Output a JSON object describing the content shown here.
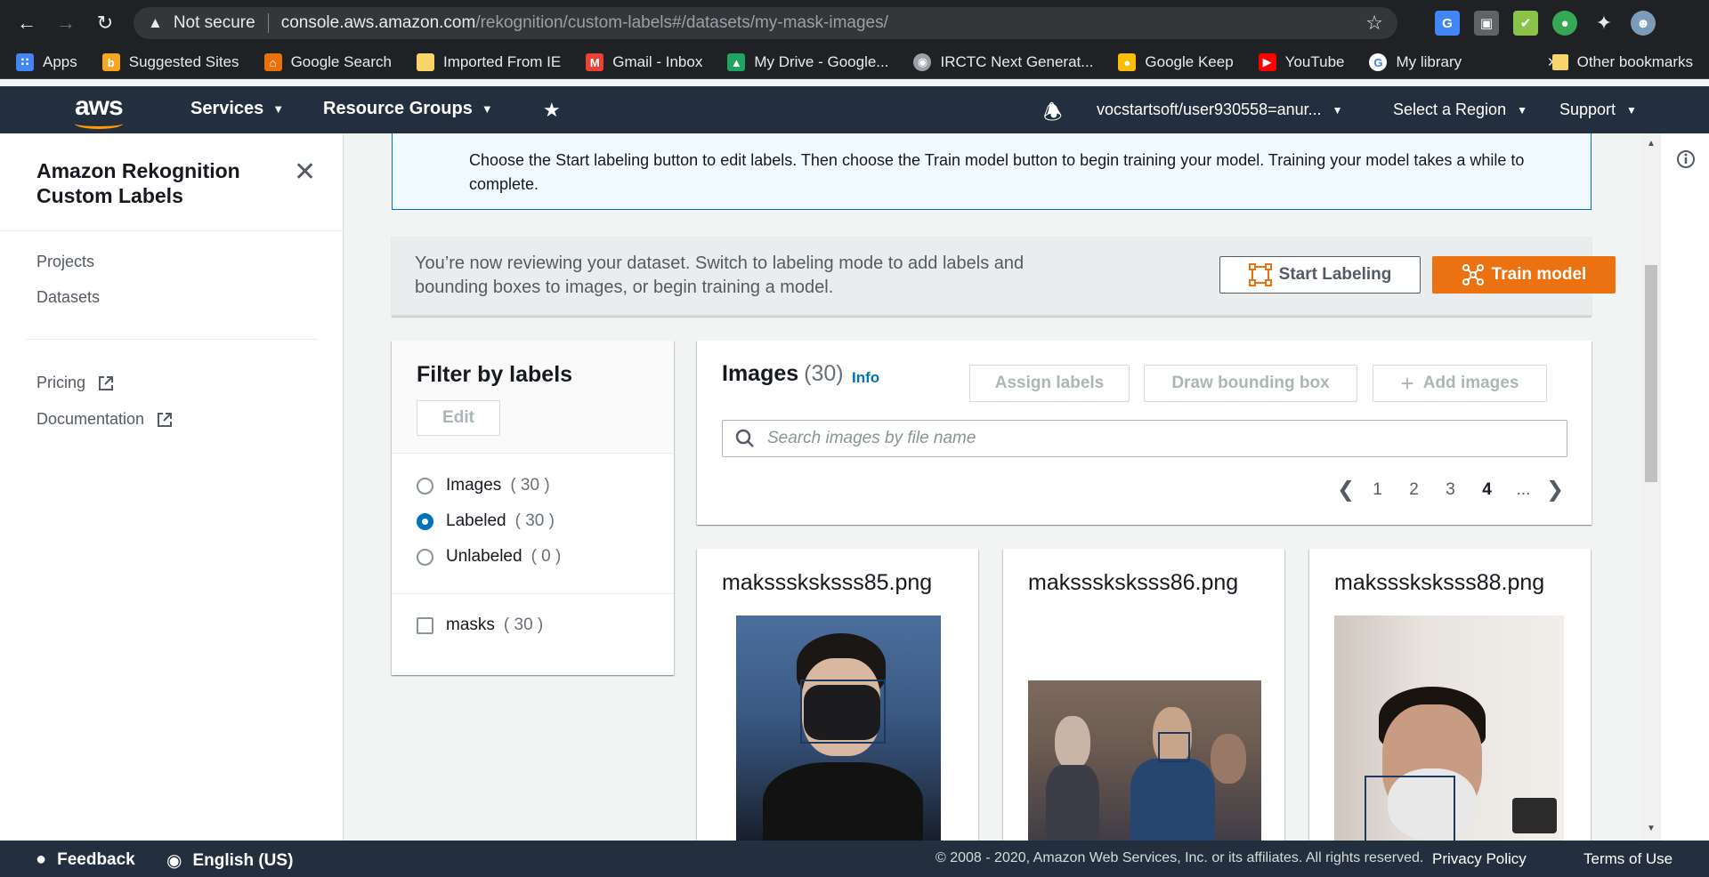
{
  "browser": {
    "security_label": "Not secure",
    "url_host": "console.aws.amazon.com",
    "url_path": "/rekognition/custom-labels#/datasets/my-mask-images/",
    "bookmarks": [
      {
        "label": "Apps",
        "icon": "apps-grid-icon",
        "color": "#4285f4"
      },
      {
        "label": "Suggested Sites",
        "icon": "suggested-sites-icon",
        "color": "#f5a623"
      },
      {
        "label": "Google Search",
        "icon": "house-icon",
        "color": "#e8710a"
      },
      {
        "label": "Imported From IE",
        "icon": "folder-icon",
        "color": "#f9d46b"
      },
      {
        "label": "Gmail - Inbox",
        "icon": "gmail-icon",
        "color": "#ea4335"
      },
      {
        "label": "My Drive - Google...",
        "icon": "drive-icon",
        "color": "#1fa463"
      },
      {
        "label": "IRCTC Next Generat...",
        "icon": "irctc-icon",
        "color": "#9aa0a6"
      },
      {
        "label": "Google Keep",
        "icon": "keep-icon",
        "color": "#fbbc04"
      },
      {
        "label": "YouTube",
        "icon": "youtube-icon",
        "color": "#ff0000"
      },
      {
        "label": "My library",
        "icon": "google-icon",
        "color": "#4285f4"
      }
    ],
    "bookmarks_more": "»",
    "other_bookmarks": "Other bookmarks"
  },
  "aws_header": {
    "logo": "aws",
    "services": "Services",
    "resource_groups": "Resource Groups",
    "account": "vocstartsoft/user930558=anur...",
    "region": "Select a Region",
    "support": "Support"
  },
  "sidebar": {
    "title": "Amazon Rekognition Custom Labels",
    "nav": [
      "Projects",
      "Datasets"
    ],
    "links": [
      "Pricing",
      "Documentation"
    ]
  },
  "info_alert": {
    "text": "Choose the Start labeling button to edit labels. Then choose the Train model button to begin training your model. Training your model takes a while to complete."
  },
  "review_bar": {
    "text": "You’re now reviewing your dataset. Switch to labeling mode to add labels and bounding boxes to images, or begin training a model.",
    "start_labeling": "Start Labeling",
    "train_model": "Train model"
  },
  "filter": {
    "title": "Filter by labels",
    "edit": "Edit",
    "radios": [
      {
        "label": "Images",
        "count": "( 30 )",
        "selected": false
      },
      {
        "label": "Labeled",
        "count": "( 30 )",
        "selected": true
      },
      {
        "label": "Unlabeled",
        "count": "( 0 )",
        "selected": false
      }
    ],
    "labels": [
      {
        "label": "masks",
        "count": "( 30 )",
        "checked": false
      }
    ]
  },
  "images": {
    "title": "Images",
    "count": "(30)",
    "info": "Info",
    "assign_labels": "Assign labels",
    "draw_bbox": "Draw bounding box",
    "add_images": "Add images",
    "search_placeholder": "Search images by file name",
    "pages": [
      "1",
      "2",
      "3",
      "4",
      "..."
    ],
    "current_page": "4",
    "cards": [
      {
        "filename": "maksssksksss85.png"
      },
      {
        "filename": "maksssksksss86.png"
      },
      {
        "filename": "maksssksksss88.png"
      }
    ]
  },
  "footer": {
    "feedback": "Feedback",
    "language": "English (US)",
    "copyright": "© 2008 - 2020, Amazon Web Services, Inc. or its affiliates. All rights reserved.",
    "privacy": "Privacy Policy",
    "terms": "Terms of Use"
  },
  "colors": {
    "aws_orange": "#ec7211",
    "aws_nav": "#232f3e",
    "link_blue": "#0073bb"
  }
}
